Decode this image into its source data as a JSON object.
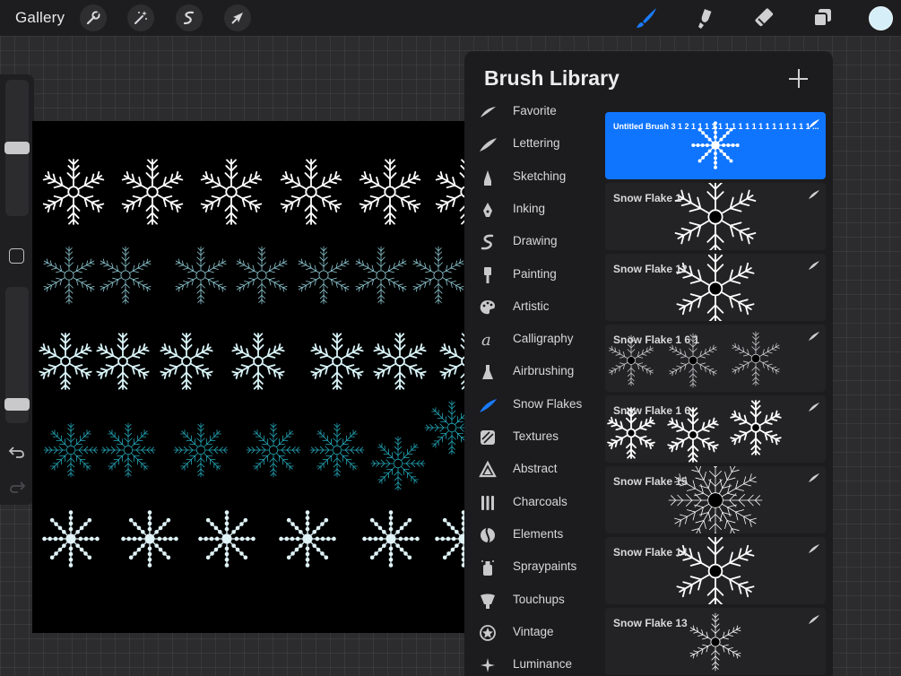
{
  "topbar": {
    "gallery_label": "Gallery",
    "left_tools": [
      "wrench-icon",
      "magic-wand-icon",
      "selection-s-icon",
      "transform-arrow-icon"
    ],
    "right_tools": [
      "brush-icon",
      "smudge-icon",
      "eraser-icon",
      "layers-icon"
    ],
    "active_tool": "brush-icon",
    "accent_color": "#1a7bff",
    "current_color": "#d6eef7"
  },
  "sidebar": {
    "size_slider_level": 0.5,
    "opacity_slider_level": 0.1,
    "icons": [
      "modify-square-icon",
      "undo-icon",
      "redo-icon"
    ]
  },
  "brush_library": {
    "title": "Brush Library",
    "categories": [
      {
        "label": "Favorite",
        "icon": "favorite-icon"
      },
      {
        "label": "Lettering",
        "icon": "lettering-icon"
      },
      {
        "label": "Sketching",
        "icon": "sketching-icon"
      },
      {
        "label": "Inking",
        "icon": "inking-icon"
      },
      {
        "label": "Drawing",
        "icon": "drawing-icon"
      },
      {
        "label": "Painting",
        "icon": "painting-icon"
      },
      {
        "label": "Artistic",
        "icon": "artistic-icon"
      },
      {
        "label": "Calligraphy",
        "icon": "calligraphy-icon"
      },
      {
        "label": "Airbrushing",
        "icon": "airbrushing-icon"
      },
      {
        "label": "Snow Flakes",
        "icon": "snow-flakes-icon"
      },
      {
        "label": "Textures",
        "icon": "textures-icon"
      },
      {
        "label": "Abstract",
        "icon": "abstract-icon"
      },
      {
        "label": "Charcoals",
        "icon": "charcoals-icon"
      },
      {
        "label": "Elements",
        "icon": "elements-icon"
      },
      {
        "label": "Spraypaints",
        "icon": "spraypaints-icon"
      },
      {
        "label": "Touchups",
        "icon": "touchups-icon"
      },
      {
        "label": "Vintage",
        "icon": "vintage-icon"
      },
      {
        "label": "Luminance",
        "icon": "luminance-icon"
      }
    ],
    "selected_category": "Snow Flakes",
    "brushes": [
      {
        "name": "Untitled Brush 3 1 2 1 1 1 1 1 1 1 1 1 1 1 1 1 1 1 1 1 1 ...",
        "selected": true
      },
      {
        "name": "Snow Flake 1",
        "selected": false
      },
      {
        "name": "Snow Flake 12",
        "selected": false
      },
      {
        "name": "Snow Flake 1 6 1",
        "selected": false
      },
      {
        "name": "Snow Flake 1 6",
        "selected": false
      },
      {
        "name": "Snow Flake 15",
        "selected": false
      },
      {
        "name": "Snow Flake 14",
        "selected": false
      },
      {
        "name": "Snow Flake 13",
        "selected": false
      }
    ]
  }
}
